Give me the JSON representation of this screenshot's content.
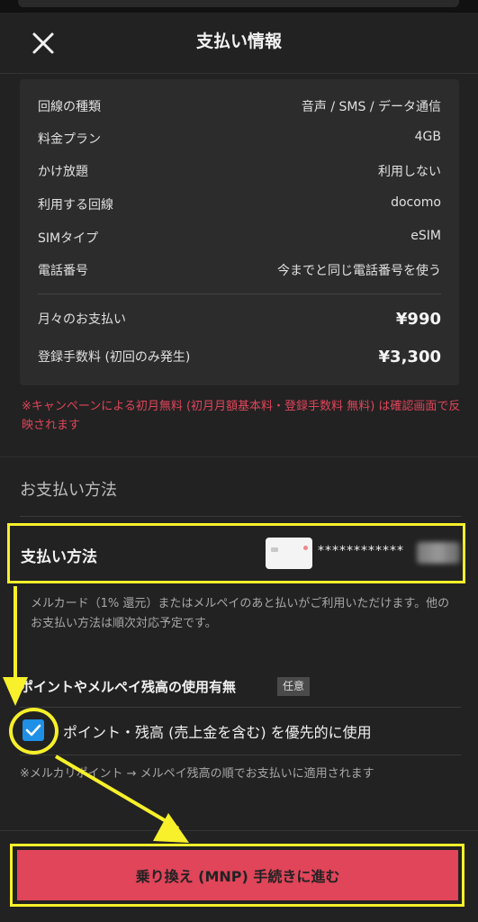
{
  "header": {
    "title": "支払い情報",
    "close_icon": "close-icon"
  },
  "summary": {
    "rows": [
      {
        "label": "回線の種類",
        "value": "音声 / SMS / データ通信"
      },
      {
        "label": "料金プラン",
        "value": "4GB"
      },
      {
        "label": "かけ放題",
        "value": "利用しない"
      },
      {
        "label": "利用する回線",
        "value": "docomo"
      },
      {
        "label": "SIMタイプ",
        "value": "eSIM"
      },
      {
        "label": "電話番号",
        "value": "今までと同じ電話番号を使う"
      }
    ],
    "totals": [
      {
        "label": "月々のお支払い",
        "value": "¥990"
      },
      {
        "label": "登録手数料 (初回のみ発生)",
        "value": "¥3,300"
      }
    ]
  },
  "notice": "※キャンペーンによる初月無料 (初月月額基本料・登録手数料 無料) は確認画面で反映されます",
  "payment_section": {
    "title": "お支払い方法",
    "row_label": "支払い方法",
    "card_number": "************",
    "description": "メルカード（1% 還元）またはメルペイのあと払いがご利用いただけます。他のお支払い方法は順次対応予定です。"
  },
  "points_section": {
    "title": "ポイントやメルペイ残高の使用有無",
    "badge": "任意",
    "checkbox_label": "ポイント・残高 (売上金を含む) を優先的に使用",
    "checked": true,
    "note": "※メルカリポイント → メルペイ残高の順でお支払いに適用されます"
  },
  "cta": {
    "label": "乗り換え (MNP) 手続きに進む"
  },
  "colors": {
    "background": "#222222",
    "card": "#2c2c2c",
    "accent": "#e0455a",
    "highlight": "#f7f02a",
    "checkbox": "#1e90e6"
  }
}
